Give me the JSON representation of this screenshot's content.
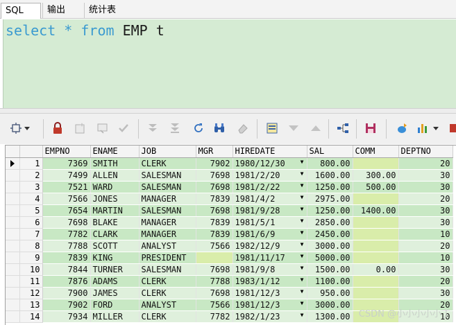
{
  "tabs": [
    {
      "label": "SQL"
    },
    {
      "label": "输出"
    },
    {
      "label": "统计表"
    }
  ],
  "editor": {
    "sql_parts": [
      {
        "text": "select",
        "type": "keyword"
      },
      {
        "text": " * ",
        "type": "keyword"
      },
      {
        "text": "from",
        "type": "keyword"
      },
      {
        "text": " EMP t",
        "type": "plain"
      }
    ]
  },
  "toolbar": {
    "icons": [
      "grid-select-icon",
      "dropdown-icon",
      "lock-icon",
      "add-record-icon",
      "delete-record-icon",
      "post-changes-icon",
      "fetch-next-icon",
      "fetch-last-icon",
      "refresh-icon",
      "find-icon",
      "clear-icon",
      "single-record-view-icon",
      "sort-desc-icon",
      "sort-asc-icon",
      "tree-icon",
      "save-icon",
      "export-icon",
      "chart-icon",
      "more-icon"
    ]
  },
  "grid": {
    "columns": [
      "EMPNO",
      "ENAME",
      "JOB",
      "MGR",
      "HIREDATE",
      "SAL",
      "COMM",
      "DEPTNO"
    ],
    "rows": [
      {
        "n": "1",
        "empno": "7369",
        "ename": "SMITH",
        "job": "CLERK",
        "mgr": "7902",
        "hiredate": "1980/12/30",
        "sal": "800.00",
        "comm": "",
        "deptno": "20"
      },
      {
        "n": "2",
        "empno": "7499",
        "ename": "ALLEN",
        "job": "SALESMAN",
        "mgr": "7698",
        "hiredate": "1981/2/20",
        "sal": "1600.00",
        "comm": "300.00",
        "deptno": "30"
      },
      {
        "n": "3",
        "empno": "7521",
        "ename": "WARD",
        "job": "SALESMAN",
        "mgr": "7698",
        "hiredate": "1981/2/22",
        "sal": "1250.00",
        "comm": "500.00",
        "deptno": "30"
      },
      {
        "n": "4",
        "empno": "7566",
        "ename": "JONES",
        "job": "MANAGER",
        "mgr": "7839",
        "hiredate": "1981/4/2",
        "sal": "2975.00",
        "comm": "",
        "deptno": "20"
      },
      {
        "n": "5",
        "empno": "7654",
        "ename": "MARTIN",
        "job": "SALESMAN",
        "mgr": "7698",
        "hiredate": "1981/9/28",
        "sal": "1250.00",
        "comm": "1400.00",
        "deptno": "30"
      },
      {
        "n": "6",
        "empno": "7698",
        "ename": "BLAKE",
        "job": "MANAGER",
        "mgr": "7839",
        "hiredate": "1981/5/1",
        "sal": "2850.00",
        "comm": "",
        "deptno": "30"
      },
      {
        "n": "7",
        "empno": "7782",
        "ename": "CLARK",
        "job": "MANAGER",
        "mgr": "7839",
        "hiredate": "1981/6/9",
        "sal": "2450.00",
        "comm": "",
        "deptno": "10"
      },
      {
        "n": "8",
        "empno": "7788",
        "ename": "SCOTT",
        "job": "ANALYST",
        "mgr": "7566",
        "hiredate": "1982/12/9",
        "sal": "3000.00",
        "comm": "",
        "deptno": "20"
      },
      {
        "n": "9",
        "empno": "7839",
        "ename": "KING",
        "job": "PRESIDENT",
        "mgr": "",
        "hiredate": "1981/11/17",
        "sal": "5000.00",
        "comm": "",
        "deptno": "10"
      },
      {
        "n": "10",
        "empno": "7844",
        "ename": "TURNER",
        "job": "SALESMAN",
        "mgr": "7698",
        "hiredate": "1981/9/8",
        "sal": "1500.00",
        "comm": "0.00",
        "deptno": "30"
      },
      {
        "n": "11",
        "empno": "7876",
        "ename": "ADAMS",
        "job": "CLERK",
        "mgr": "7788",
        "hiredate": "1983/1/12",
        "sal": "1100.00",
        "comm": "",
        "deptno": "20"
      },
      {
        "n": "12",
        "empno": "7900",
        "ename": "JAMES",
        "job": "CLERK",
        "mgr": "7698",
        "hiredate": "1981/12/3",
        "sal": "950.00",
        "comm": "",
        "deptno": "30"
      },
      {
        "n": "13",
        "empno": "7902",
        "ename": "FORD",
        "job": "ANALYST",
        "mgr": "7566",
        "hiredate": "1981/12/3",
        "sal": "3000.00",
        "comm": "",
        "deptno": "20"
      },
      {
        "n": "14",
        "empno": "7934",
        "ename": "MILLER",
        "job": "CLERK",
        "mgr": "7782",
        "hiredate": "1982/1/23",
        "sal": "1300.00",
        "comm": "",
        "deptno": "10"
      }
    ],
    "current_row": 0
  },
  "watermark": "CSDN @小小小小小丁",
  "colors": {
    "editor_bg": "#d5ebd3",
    "keyword": "#3a9ad0",
    "row_even": "#c8e8c4",
    "row_odd": "#dff0dc"
  }
}
